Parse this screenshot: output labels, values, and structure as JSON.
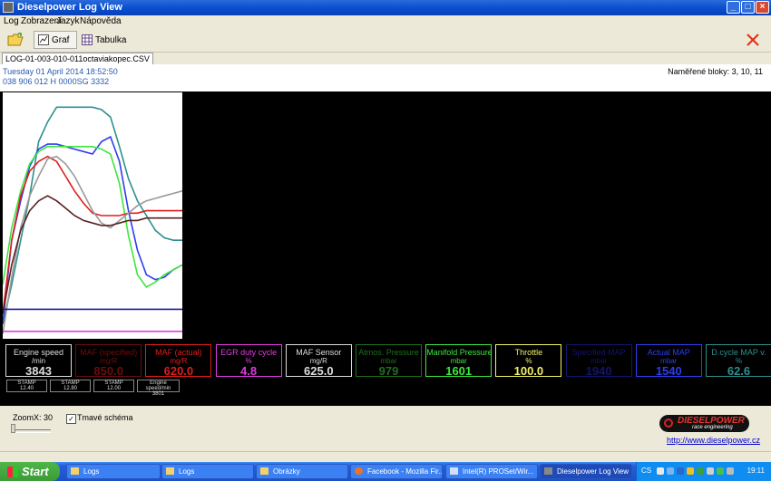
{
  "window": {
    "title": "Dieselpower Log View",
    "btn_min": "_",
    "btn_max": "□",
    "btn_close": "×"
  },
  "menu": [
    "Log",
    "Zobrazení",
    "Jazyk",
    "Nápověda"
  ],
  "toolbar": {
    "graph_label": "Graf",
    "table_label": "Tabulka",
    "open_icon": "folder-open-icon",
    "close_icon": "red-x-icon"
  },
  "tab": {
    "filename": "LOG-01-003-010-011octaviakopec.CSV"
  },
  "info": {
    "date": "Tuesday 01 April 2014 18:52:50",
    "ecu": "038 906 012 H  0000SG  3332",
    "blocks": "Naměřené bloky: 3, 10, 11"
  },
  "gauges": [
    {
      "name": "Engine speed",
      "unit": "/min",
      "value": "3843",
      "color": "#dddddd"
    },
    {
      "name": "MAF (specified)",
      "unit": "mg/R",
      "value": "850.0",
      "color": "#6b0e0e"
    },
    {
      "name": "MAF (actual)",
      "unit": "mg/R",
      "value": "620.0",
      "color": "#e01c1c"
    },
    {
      "name": "EGR duty cycle",
      "unit": "%",
      "value": "4.8",
      "color": "#e03ce0"
    },
    {
      "name": "MAF Sensor",
      "unit": "mg/R",
      "value": "625.0",
      "color": "#dddddd"
    },
    {
      "name": "Atmos. Pressure",
      "unit": "mbar",
      "value": "979",
      "color": "#1f6e1f"
    },
    {
      "name": "Manifold Pressure",
      "unit": "mbar",
      "value": "1601",
      "color": "#3ee63e"
    },
    {
      "name": "Throttle",
      "unit": "%",
      "value": "100.0",
      "color": "#f1f16a"
    },
    {
      "name": "Specified MAP",
      "unit": "mbar",
      "value": "1940",
      "color": "#14146e"
    },
    {
      "name": "Actual MAP",
      "unit": "mbar",
      "value": "1540",
      "color": "#2f3cf2"
    },
    {
      "name": "D.cycle MAP v.",
      "unit": "%",
      "value": "62.6",
      "color": "#2e8f8f"
    }
  ],
  "stamps": [
    {
      "label": "STAMP",
      "value": "12.40"
    },
    {
      "label": "STAMP",
      "value": "12.80"
    },
    {
      "label": "STAMP",
      "value": "12.00"
    },
    {
      "label": "Engine speed/min",
      "value": "3801"
    }
  ],
  "bottom": {
    "zoom_label": "ZoomX: 30",
    "zoom_level": 0.0,
    "dark_scheme_label": "Tmavé schéma",
    "dark_scheme_checked": true,
    "check_mark": "✓",
    "website": "http://www.dieselpower.cz"
  },
  "logo": {
    "brand": "DIESELPOWER",
    "tagline": "race engineering"
  },
  "taskbar": {
    "start": "Start",
    "tasks": [
      "Logs",
      "Logs",
      "Obrázky",
      "Facebook - Mozilla Fir...",
      "Intel(R) PROSet/Wir...",
      "Dieselpower Log View"
    ],
    "lang": "CS",
    "clock": "19:11"
  },
  "chart_data": {
    "type": "line",
    "x": [
      0,
      0.05,
      0.1,
      0.15,
      0.2,
      0.25,
      0.3,
      0.35,
      0.4,
      0.45,
      0.5,
      0.55,
      0.6,
      0.65,
      0.7,
      0.75,
      0.8,
      0.85,
      0.9,
      0.95,
      1.0
    ],
    "ylim": [
      0,
      1
    ],
    "series": [
      {
        "color": "#2e8f8f",
        "values": [
          0.06,
          0.22,
          0.4,
          0.58,
          0.8,
          0.88,
          0.94,
          0.94,
          0.94,
          0.94,
          0.94,
          0.93,
          0.9,
          0.78,
          0.65,
          0.56,
          0.5,
          0.44,
          0.41,
          0.4,
          0.4
        ]
      },
      {
        "color": "#2f3cf2",
        "values": [
          0.06,
          0.4,
          0.56,
          0.7,
          0.77,
          0.79,
          0.79,
          0.78,
          0.77,
          0.76,
          0.75,
          0.8,
          0.82,
          0.72,
          0.52,
          0.36,
          0.26,
          0.24,
          0.25,
          0.28,
          0.3
        ]
      },
      {
        "color": "#3ee63e",
        "values": [
          0.22,
          0.45,
          0.6,
          0.71,
          0.76,
          0.78,
          0.78,
          0.78,
          0.78,
          0.78,
          0.78,
          0.77,
          0.75,
          0.63,
          0.42,
          0.26,
          0.21,
          0.23,
          0.26,
          0.28,
          0.3
        ]
      },
      {
        "color": "#e01c1c",
        "values": [
          0.1,
          0.4,
          0.58,
          0.68,
          0.72,
          0.74,
          0.72,
          0.66,
          0.6,
          0.55,
          0.51,
          0.5,
          0.5,
          0.5,
          0.51,
          0.51,
          0.52,
          0.52,
          0.52,
          0.52,
          0.52
        ]
      },
      {
        "color": "#999999",
        "values": [
          0.02,
          0.25,
          0.45,
          0.58,
          0.66,
          0.73,
          0.74,
          0.71,
          0.66,
          0.59,
          0.52,
          0.47,
          0.45,
          0.48,
          0.51,
          0.54,
          0.56,
          0.57,
          0.58,
          0.59,
          0.6
        ]
      },
      {
        "color": "#5a2020",
        "values": [
          0.1,
          0.3,
          0.44,
          0.52,
          0.56,
          0.58,
          0.56,
          0.53,
          0.5,
          0.48,
          0.47,
          0.46,
          0.46,
          0.47,
          0.48,
          0.48,
          0.49,
          0.49,
          0.49,
          0.49,
          0.49
        ]
      },
      {
        "color": "#1a1aa0",
        "values": [
          0.12,
          0.12,
          0.12,
          0.12,
          0.12,
          0.12,
          0.12,
          0.12,
          0.12,
          0.12,
          0.12,
          0.12,
          0.12,
          0.12,
          0.12,
          0.12,
          0.12,
          0.12,
          0.12,
          0.12,
          0.12
        ]
      },
      {
        "color": "#e03ce0",
        "values": [
          0.03,
          0.03,
          0.03,
          0.03,
          0.03,
          0.03,
          0.03,
          0.03,
          0.03,
          0.03,
          0.03,
          0.03,
          0.03,
          0.03,
          0.03,
          0.03,
          0.03,
          0.03,
          0.03,
          0.03,
          0.03
        ]
      }
    ]
  }
}
